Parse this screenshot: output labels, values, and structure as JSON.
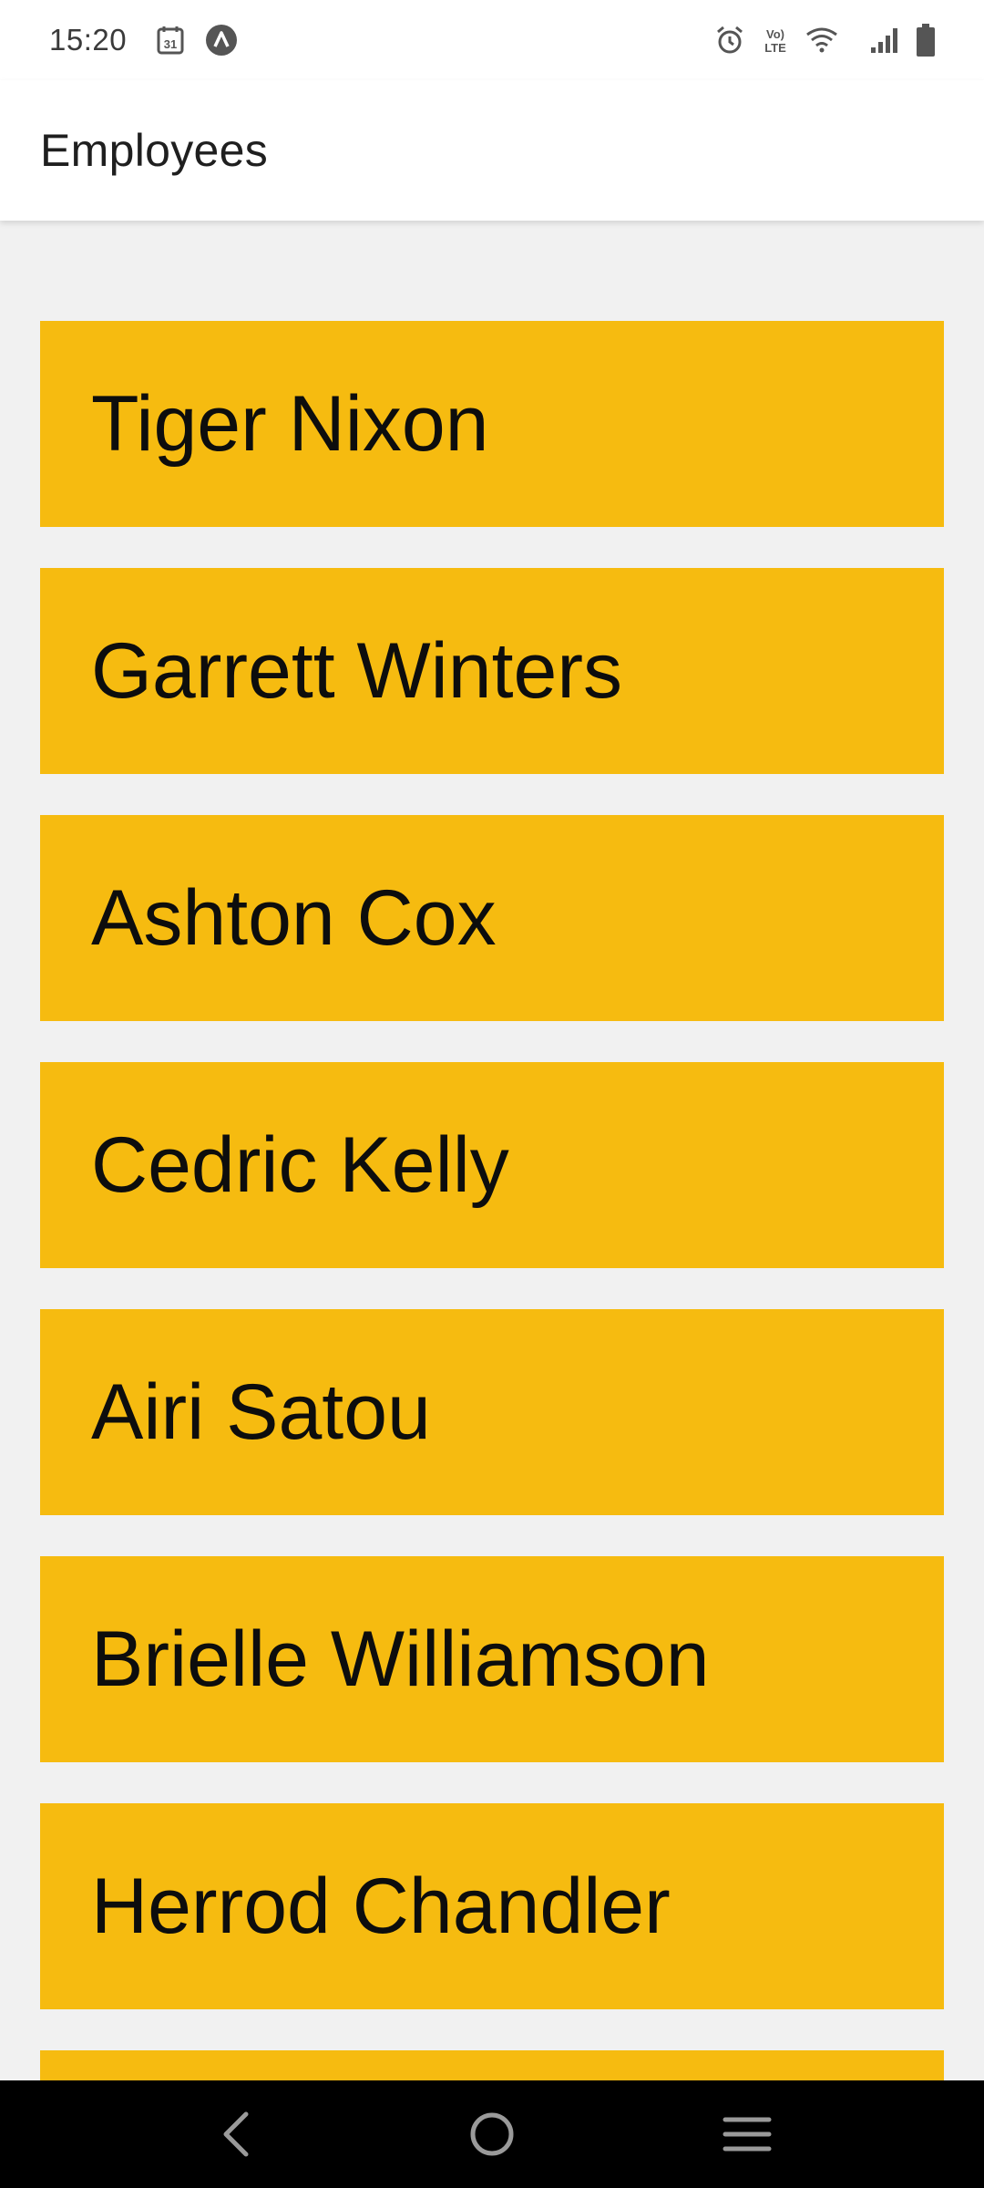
{
  "status_bar": {
    "time": "15:20",
    "calendar_day": "31",
    "icons_left": [
      "calendar-icon",
      "app-notification-icon"
    ],
    "icons_right": [
      "alarm-icon",
      "volte-icon",
      "wifi-icon",
      "signal-icon",
      "battery-icon"
    ],
    "volte_top": "Vo)",
    "volte_bottom": "LTE"
  },
  "app_bar": {
    "title": "Employees"
  },
  "employees": [
    {
      "name": "Tiger Nixon"
    },
    {
      "name": "Garrett Winters"
    },
    {
      "name": "Ashton Cox"
    },
    {
      "name": "Cedric Kelly"
    },
    {
      "name": "Airi Satou"
    },
    {
      "name": "Brielle Williamson"
    },
    {
      "name": "Herrod Chandler"
    },
    {
      "name": ""
    }
  ],
  "nav_bar": {
    "buttons": [
      "back-icon",
      "home-icon",
      "recents-icon"
    ]
  },
  "colors": {
    "card": "#f6bb10",
    "background": "#f1f1f1",
    "app_bar": "#ffffff",
    "nav_bar": "#000000"
  }
}
